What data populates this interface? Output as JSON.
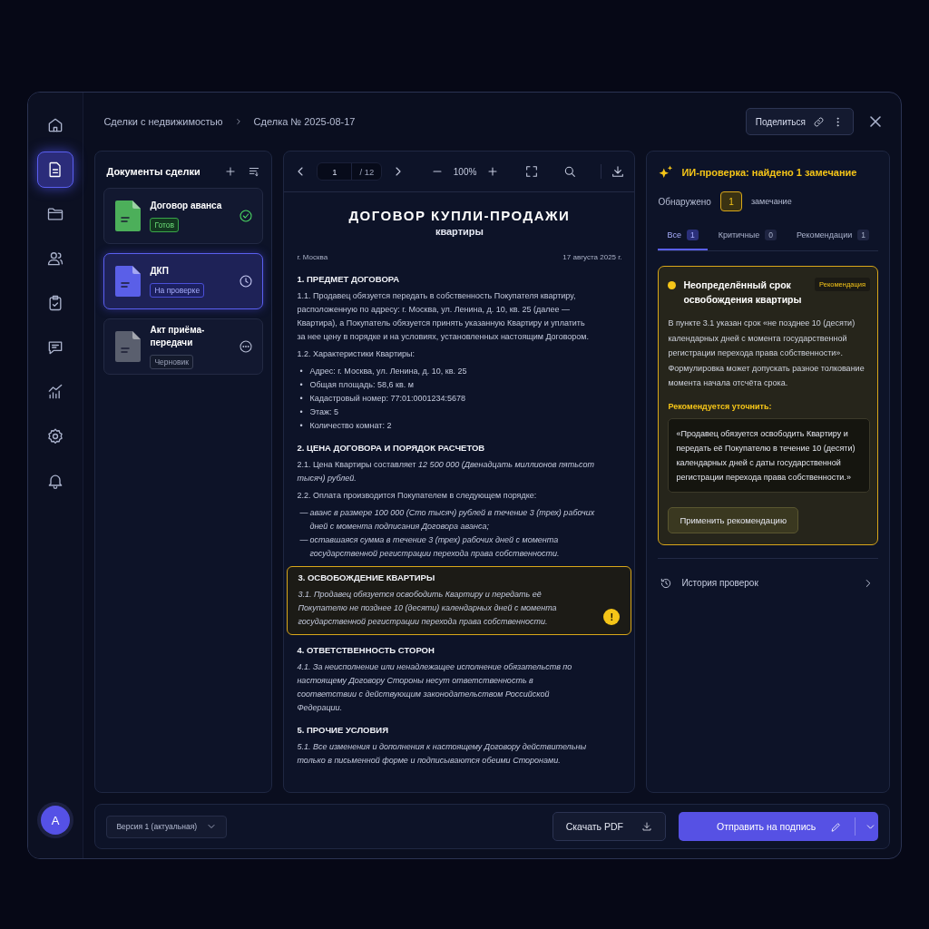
{
  "nav": {
    "items": [
      {
        "selected": false
      },
      {
        "selected": true
      },
      {
        "selected": false
      },
      {
        "selected": false
      },
      {
        "selected": false
      },
      {
        "selected": false
      },
      {
        "selected": false
      },
      {
        "selected": false
      },
      {
        "selected": false
      }
    ],
    "avatar": "A"
  },
  "breadcrumb": [
    "Сделки с недвижимостью",
    "Сделка № 2025-08-17"
  ],
  "share_button": "Поделиться",
  "documents": {
    "title": "Документы сделки",
    "items": [
      {
        "name": "Договор аванса",
        "status": "Готов",
        "kind": "ready",
        "selected": false
      },
      {
        "name": "ДКП",
        "status": "На проверке",
        "kind": "review",
        "selected": true
      },
      {
        "name": "Акт приёма-передачи",
        "status": "Черновик",
        "kind": "draft",
        "selected": false
      }
    ]
  },
  "viewer": {
    "page": "1",
    "total": "/ 12",
    "zoom": "100%",
    "document": {
      "title": "ДОГОВОР КУПЛИ-ПРОДАЖИ",
      "subtitle": "квартиры",
      "city": "г. Москва",
      "date": "17 августа 2025 г.",
      "sections": [
        {
          "heading": "1. ПРЕДМЕТ ДОГОВОРА",
          "highlighted": false,
          "blocks": [
            {
              "kind": "para",
              "italic": false,
              "text": "1.1. Продавец обязуется передать в собственность Покупателя квартиру, расположенную по адресу: г. Москва, ул. Ленина, д. 10, кв. 25 (далее — Квартира), а Покупатель обязуется принять указанную Квартиру и уплатить за нее цену в порядке и на условиях, установленных настоящим Договором."
            },
            {
              "kind": "para",
              "italic": false,
              "text": "1.2. Характеристики Квартиры:"
            },
            {
              "kind": "bullets",
              "marker": "•",
              "items": [
                "Адрес: г. Москва, ул. Ленина, д. 10, кв. 25",
                "Общая площадь: 58,6 кв. м",
                "Кадастровый номер: 77:01:0001234:5678",
                "Этаж: 5",
                "Количество комнат: 2"
              ]
            }
          ]
        },
        {
          "heading": "2. ЦЕНА ДОГОВОРА И ПОРЯДОК РАСЧЕТОВ",
          "highlighted": false,
          "blocks": [
            {
              "kind": "para",
              "italic": false,
              "text": "2.1. Цена Квартиры составляет *12 500 000 (Двенадцать миллионов пятьсот тысяч) рублей.*"
            },
            {
              "kind": "para",
              "italic": false,
              "text": "2.2. Оплата производится Покупателем в следующем порядке:"
            },
            {
              "kind": "bullets",
              "marker": "—",
              "items": [
                "*аванс в размере 100 000 (Сто тысяч) рублей в течение 3 (трех) рабочих дней с момента подписания Договора аванса;*",
                "*оставшаяся сумма в течение 3 (трех) рабочих дней с момента государственной регистрации перехода права собственности.*"
              ]
            }
          ]
        },
        {
          "heading": "3. ОСВОБОЖДЕНИЕ КВАРТИРЫ",
          "highlighted": true,
          "warning": "!",
          "blocks": [
            {
              "kind": "para",
              "italic": true,
              "text": "3.1. Продавец обязуется освободить Квартиру и передать её Покупателю не позднее 10 (десяти) календарных дней с момента государственной регистрации перехода права собственности."
            }
          ]
        },
        {
          "heading": "4. ОТВЕТСТВЕННОСТЬ СТОРОН",
          "highlighted": false,
          "blocks": [
            {
              "kind": "para",
              "italic": true,
              "text": "4.1. За неисполнение или ненадлежащее исполнение обязательств по настоящему Договору Стороны несут ответственность в соответствии с действующим законодательством Российской Федерации."
            }
          ]
        },
        {
          "heading": "5. ПРОЧИЕ УСЛОВИЯ",
          "highlighted": false,
          "blocks": [
            {
              "kind": "para",
              "italic": true,
              "text": "5.1. Все изменения и дополнения к настоящему Договору действительны только в письменной форме и подписываются обеими Сторонами."
            }
          ]
        }
      ]
    }
  },
  "review": {
    "title": "ИИ-проверка: найдено 1 замечание",
    "detected": "Обнаружено",
    "count": "1",
    "count_suffix": "замечание",
    "tabs": [
      {
        "label": "Все",
        "count": "1",
        "selected": true
      },
      {
        "label": "Критичные",
        "count": "0",
        "selected": false
      },
      {
        "label": "Рекомендации",
        "count": "1",
        "selected": false
      }
    ],
    "issue": {
      "color": "#f5c518",
      "title": "Неопределённый срок освобождения квартиры",
      "tag": "Рекомендация",
      "text": "В пункте 3.1 указан срок «не позднее 10 (десяти) календарных дней с момента государственной регистрации перехода права собственности». Формулировка может допускать разное толкование момента начала отсчёта срока.",
      "suggest_label": "Рекомендуется уточнить:",
      "quote": "«Продавец обязуется освободить Квартиру и передать её Покупателю в течение 10 (десяти) календарных дней с даты государственной регистрации перехода права собственности.»",
      "apply_button": "Применить рекомендацию"
    },
    "history": "История проверок"
  },
  "footer": {
    "version": "Версия 1 (актуальная)",
    "download": "Скачать PDF",
    "send": "Отправить на подпись"
  }
}
